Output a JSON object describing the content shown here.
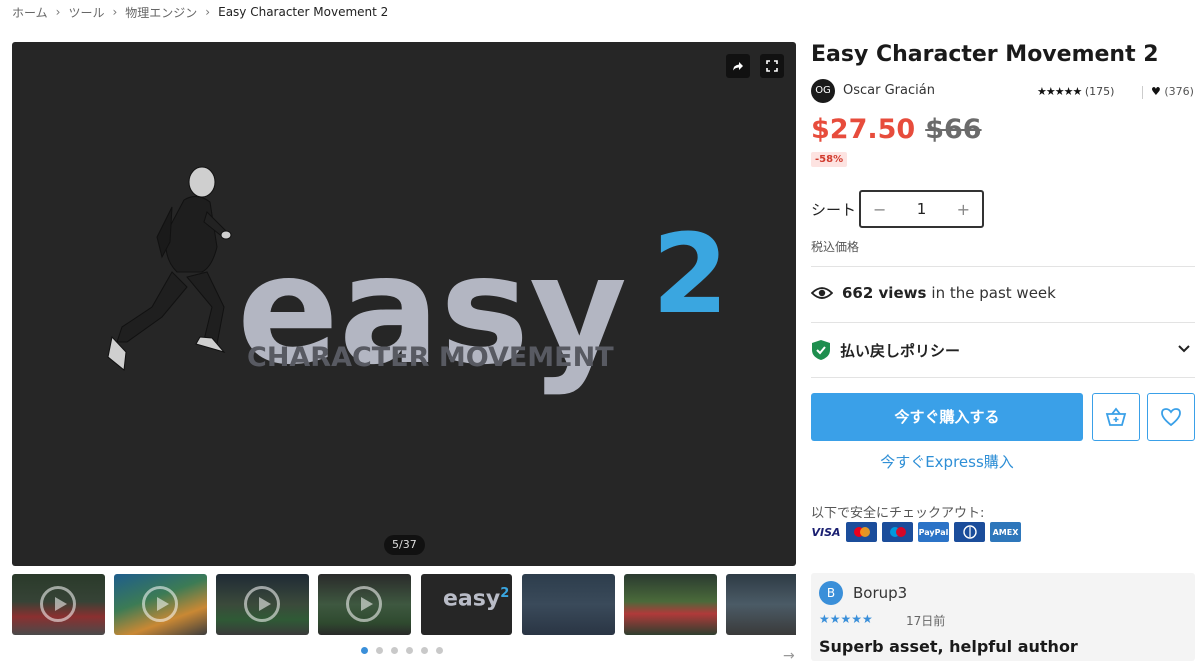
{
  "breadcrumb": [
    "ホーム",
    "ツール",
    "物理エンジン",
    "Easy Character Movement 2"
  ],
  "viewer": {
    "slide_counter": "5/37",
    "hero_logo_main": "easy",
    "hero_logo_sup": "2",
    "hero_subtitle": "CHARACTER MOVEMENT",
    "thumbnail_logo_main": "easy",
    "thumbnail_logo_sup": "2",
    "active_dot": 0,
    "dot_count": 6
  },
  "product": {
    "title": "Easy Character Movement 2",
    "author_initials": "OG",
    "author_name": "Oscar Gracián",
    "stars": "★★★★★",
    "rating_count": "(175)",
    "favorites_count": "(376)",
    "price": "$27.50",
    "old_price": "$66",
    "discount": "-58%",
    "seat_label": "シート",
    "quantity": "1",
    "tax_label": "税込価格",
    "views_count": "662 views",
    "views_suffix": "in the past week",
    "refund_policy": "払い戻しポリシー",
    "buy_now": "今すぐ購入する",
    "express_buy": "今すぐExpress購入",
    "checkout_label": "以下で安全にチェックアウト:"
  },
  "payments": [
    "VISA",
    "MC",
    "MAESTRO",
    "PayPal",
    "Diners",
    "AMEX"
  ],
  "review": {
    "initial": "B",
    "name": "Borup3",
    "stars": "★★★★★",
    "date": "17日前",
    "title": "Superb asset, helpful author"
  },
  "colors": {
    "accent": "#3aa0e8",
    "price": "#e74c3c",
    "viewer_bg": "#262626"
  }
}
